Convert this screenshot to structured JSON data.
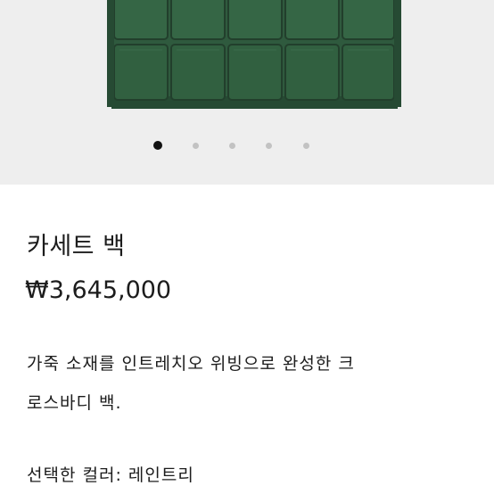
{
  "product": {
    "title": "카세트 백",
    "price": "₩3,645,000",
    "description_line1": "가죽 소재를 인트레치오 위빙으로 완성한 크",
    "description_line2": "로스바디 백.",
    "selected_color_label": "선택한 컬러:",
    "selected_color_value": "레인트리"
  },
  "gallery": {
    "image_count": 5,
    "active_index": 0,
    "bag_color": "#2f5a3e",
    "background": "#eeeeee"
  }
}
